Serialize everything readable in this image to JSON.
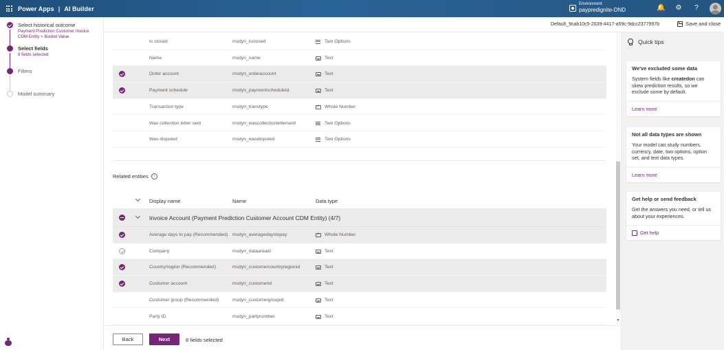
{
  "header": {
    "app_name": "Power Apps",
    "separator": "|",
    "product": "AI Builder",
    "env_label": "Environment",
    "env_name": "paypredignite-DND"
  },
  "subheader": {
    "model_id": "Default_9cab10c5-2039-4417-a59c-9dcc2377997b",
    "save_close": "Save and close"
  },
  "steps": [
    {
      "title": "Select historical outcome",
      "sub1": "Payment Prediction Customer Invoice",
      "sub2": "CDM Entity > Bucket Value"
    },
    {
      "title": "Select fields",
      "sub1": "8 fields selected"
    },
    {
      "title": "Filters"
    },
    {
      "title": "Model summary"
    }
  ],
  "top_rows": [
    {
      "name": "Is closed",
      "api": "msdyn_isclosed",
      "type": "Two Options",
      "icon": "two-options-icon",
      "selected": false
    },
    {
      "name": "Name",
      "api": "msdyn_name",
      "type": "Text",
      "icon": "text-type-icon",
      "selected": false
    },
    {
      "name": "Order account",
      "api": "msdyn_orderaccount",
      "type": "Text",
      "icon": "text-type-icon",
      "selected": true
    },
    {
      "name": "Payment schedule",
      "api": "msdyn_paymentscheduleid",
      "type": "Text",
      "icon": "text-type-icon",
      "selected": true
    },
    {
      "name": "Transaction type",
      "api": "msdyn_transtype",
      "type": "Whole Number",
      "icon": "number-type-icon",
      "selected": false
    },
    {
      "name": "Was collection letter sent",
      "api": "msdyn_wascollectionlettersent",
      "type": "Two Options",
      "icon": "two-options-icon",
      "selected": false
    },
    {
      "name": "Was disputed",
      "api": "msdyn_wasdisputed",
      "type": "Two Options",
      "icon": "two-options-icon",
      "selected": false
    }
  ],
  "related": {
    "label": "Related entities",
    "info": "i",
    "columns": {
      "display": "Display name",
      "name": "Name",
      "type": "Data type"
    },
    "group_title": "Invoice Account (Payment Prediction Customer Account CDM Entity) (4/7)",
    "rows": [
      {
        "name": "Average days to pay (Recommended)",
        "api": "msdyn_averagedaystopay",
        "type": "Whole Number",
        "icon": "number-type-icon",
        "state": "on"
      },
      {
        "name": "Company",
        "api": "msdyn_dataareaid",
        "type": "Text",
        "icon": "text-type-icon",
        "state": "grey"
      },
      {
        "name": "Country/region (Recommended)",
        "api": "msdyn_customercountryregionid",
        "type": "Text",
        "icon": "text-type-icon",
        "state": "on"
      },
      {
        "name": "Customer account",
        "api": "msdyn_customerid",
        "type": "Text",
        "icon": "text-type-icon",
        "state": "on"
      },
      {
        "name": "Customer group (Recommended)",
        "api": "msdyn_customergroupid",
        "type": "Text",
        "icon": "text-type-icon",
        "state": "off"
      },
      {
        "name": "Party ID",
        "api": "msdyn_partynumber",
        "type": "Text",
        "icon": "text-type-icon",
        "state": "off"
      }
    ]
  },
  "footer": {
    "back": "Back",
    "next": "Next",
    "count": "8 fields selected"
  },
  "quick_tips": {
    "title": "Quick tips",
    "cards": [
      {
        "title": "We've excluded some data",
        "body_pre": "System fields like ",
        "body_bold": "createdon",
        "body_post": " can skew prediction results, so we exclude some by default.",
        "link": "Learn more"
      },
      {
        "title": "Not all data types are shown",
        "body": "Your model can study numbers, currency, date, two options, option set, and text data types.",
        "link": "Learn more"
      },
      {
        "title": "Get help or send feedback",
        "body": "Get the answers you need, or tell us about your experiences.",
        "link": "Get help"
      }
    ]
  },
  "colors": {
    "accent": "#742774",
    "header": "#2b6499",
    "panel": "#f3f2f1"
  }
}
